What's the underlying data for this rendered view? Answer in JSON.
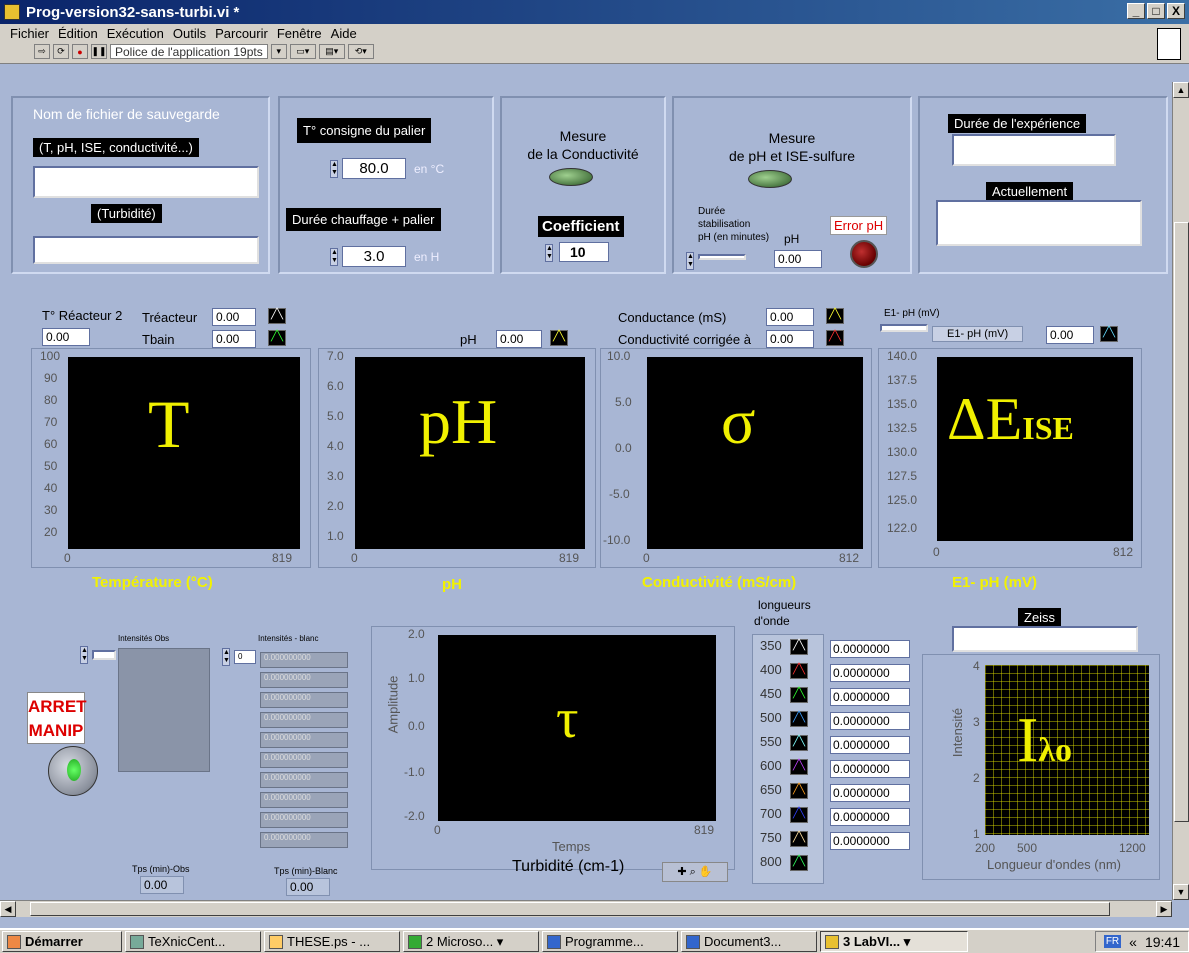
{
  "window": {
    "title": "Prog-version32-sans-turbi.vi *",
    "controls": [
      "_",
      "□",
      "X"
    ]
  },
  "menu": [
    "Fichier",
    "Édition",
    "Exécution",
    "Outils",
    "Parcourir",
    "Fenêtre",
    "Aide"
  ],
  "toolbar": {
    "font_select": "Police de l'application 19pts"
  },
  "file_panel": {
    "title": "Nom de fichier de sauvegarde",
    "label1": "(T, pH, ISE, conductivité...)",
    "label2": "(Turbidité)"
  },
  "temp_panel": {
    "setpoint_label": "T° consigne du palier",
    "setpoint_value": "80.0",
    "setpoint_unit": "en °C",
    "duration_label": "Durée chauffage + palier",
    "duration_value": "3.0",
    "duration_unit": "en H"
  },
  "cond_panel": {
    "title1": "Mesure",
    "title2": "de la Conductivité",
    "coef_label": "Coefficient",
    "coef_value": "10"
  },
  "ph_panel": {
    "title1": "Mesure",
    "title2": "de pH et ISE-sulfure",
    "stab_label1": "Durée",
    "stab_label2": "stabilisation",
    "stab_label3": "pH (en minutes)",
    "ph_label": "pH",
    "ph_value": "0.00",
    "error_label": "Error pH"
  },
  "duration_panel": {
    "label": "Durée de l'expérience",
    "now_label": "Actuellement"
  },
  "chart_T": {
    "title": "Température (°C)",
    "reactor_label": "T° Réacteur 2",
    "reactor_value": "0.00",
    "legend1": "Tréacteur",
    "legend1_value": "0.00",
    "legend2": "Tbain",
    "legend2_value": "0.00",
    "symbol": "T",
    "yticks": [
      "100",
      "90",
      "80",
      "70",
      "60",
      "50",
      "40",
      "30",
      "20"
    ],
    "xmin": "0",
    "xmax": "819"
  },
  "chart_pH": {
    "title": "pH",
    "legend": "pH",
    "legend_value": "0.00",
    "symbol": "pH",
    "yticks": [
      "7.0",
      "6.0",
      "5.0",
      "4.0",
      "3.0",
      "2.0",
      "1.0"
    ],
    "xmin": "0",
    "xmax": "819"
  },
  "chart_sigma": {
    "title": "Conductivité (mS/cm)",
    "legend1": "Conductance (mS)",
    "legend1_value": "0.00",
    "legend2": "Conductivité corrigée à",
    "legend2_value": "0.00",
    "symbol": "σ",
    "yticks": [
      "10.0",
      "5.0",
      "0.0",
      "-5.0",
      "-10.0"
    ],
    "xmin": "0",
    "xmax": "812"
  },
  "chart_E": {
    "title": "E1- pH (mV)",
    "top_label": "E1- pH (mV)",
    "legend": "E1- pH (mV)",
    "legend_value": "0.00",
    "symbol": "ΔE",
    "subscript": "ISE",
    "yticks": [
      "140.0",
      "137.5",
      "135.0",
      "132.5",
      "130.0",
      "127.5",
      "125.0",
      "122.0"
    ],
    "xmin": "0",
    "xmax": "812"
  },
  "intensities": {
    "obs_label": "Intensités Obs",
    "blank_label": "Intensités - blanc",
    "blank_index": "0",
    "blank_values": [
      "0.000000000",
      "0.000000000",
      "0.000000000",
      "0.000000000",
      "0.000000000",
      "0.000000000",
      "0.000000000",
      "0.000000000",
      "0.000000000",
      "0.000000000"
    ],
    "tps_obs_label": "Tps (min)-Obs",
    "tps_obs_value": "0.00",
    "tps_blank_label": "Tps (min)-Blanc",
    "tps_blank_value": "0.00"
  },
  "stop_button": {
    "line1": "ARRET",
    "line2": "MANIP"
  },
  "chart_tau": {
    "ylabel": "Amplitude",
    "xlabel": "Temps",
    "symbol": "τ",
    "yticks": [
      "2.0",
      "1.0",
      "0.0",
      "-1.0",
      "-2.0"
    ],
    "xmin": "0",
    "xmax": "819",
    "title": "Turbidité (cm-1)"
  },
  "wavelengths": {
    "title1": "longueurs",
    "title2": "d'onde",
    "items": [
      {
        "nm": "350",
        "color": "#ffffff",
        "value": "0.0000000"
      },
      {
        "nm": "400",
        "color": "#ff3030",
        "value": "0.0000000"
      },
      {
        "nm": "450",
        "color": "#30ff30",
        "value": "0.0000000"
      },
      {
        "nm": "500",
        "color": "#40a0ff",
        "value": "0.0000000"
      },
      {
        "nm": "550",
        "color": "#80ffff",
        "value": "0.0000000"
      },
      {
        "nm": "600",
        "color": "#c040ff",
        "value": "0.0000000"
      },
      {
        "nm": "650",
        "color": "#ffa020",
        "value": "0.0000000"
      },
      {
        "nm": "700",
        "color": "#3040ff",
        "value": "0.0000000"
      },
      {
        "nm": "750",
        "color": "#ffe0a0",
        "value": "0.0000000"
      },
      {
        "nm": "800",
        "color": "#30ff60",
        "value": ""
      }
    ]
  },
  "chart_zeiss": {
    "label": "Zeiss",
    "ylabel": "Intensité",
    "xlabel": "Longueur d'ondes (nm)",
    "symbol": "I",
    "subscript": "λo",
    "yticks": [
      "4",
      "3",
      "2",
      "1"
    ],
    "xticks": [
      "200",
      "500",
      "1200"
    ]
  },
  "taskbar": {
    "start": "Démarrer",
    "items": [
      "TeXnicCent...",
      "THESE.ps - ...",
      "2 Microso...",
      "Programme...",
      "Document3...",
      "3 LabVI..."
    ],
    "lang": "FR",
    "clock": "19:41"
  }
}
